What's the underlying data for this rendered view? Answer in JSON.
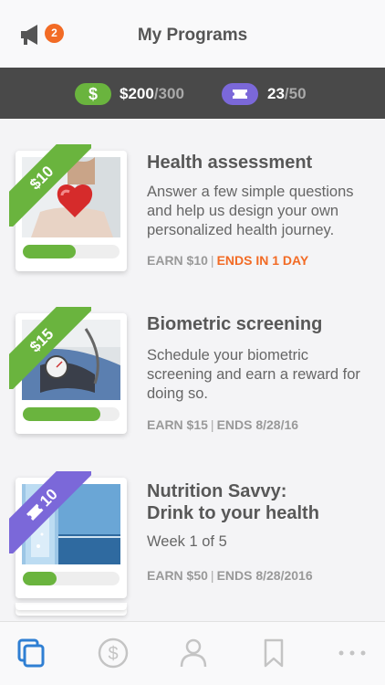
{
  "header": {
    "title": "My Programs",
    "notification_count": "2",
    "megaphone_icon": "megaphone-icon"
  },
  "balance": {
    "dollar_symbol": "$",
    "dollar_amount": "$200",
    "dollar_max": "/300",
    "ticket_amount": "23",
    "ticket_max": "/50",
    "ticket_icon": "ticket-icon"
  },
  "programs": [
    {
      "badge": "$10",
      "title": "Health assessment",
      "description": "Answer a few simple questions and help us design your own personalized health journey.",
      "earn": "EARN $10",
      "deadline": "ENDS IN 1 DAY",
      "progress": 0.55,
      "image": "heart-in-hands-image"
    },
    {
      "badge": "$15",
      "title": "Biometric screening",
      "description": "Schedule your biometric screening and earn a reward for doing so.",
      "earn": "EARN $15",
      "deadline": "ENDS 8/28/16",
      "progress": 0.8,
      "image": "blood-pressure-cuff-image"
    },
    {
      "badge": "10",
      "title_line1": "Nutrition Savvy:",
      "title_line2": "Drink to your health",
      "description": "Week 1 of 5",
      "earn": "EARN $50",
      "deadline": "ENDS 8/28/2016",
      "progress": 0.35,
      "image": "water-and-lake-image"
    }
  ],
  "tabbar": {
    "items": [
      "programs-icon",
      "rewards-icon",
      "profile-icon",
      "bookmark-icon",
      "more-icon"
    ]
  },
  "colors": {
    "green": "#6ab43e",
    "purple": "#7b68d9",
    "orange": "#f26b25",
    "dark_bar": "#494949",
    "active_tab": "#2f7fd3"
  }
}
